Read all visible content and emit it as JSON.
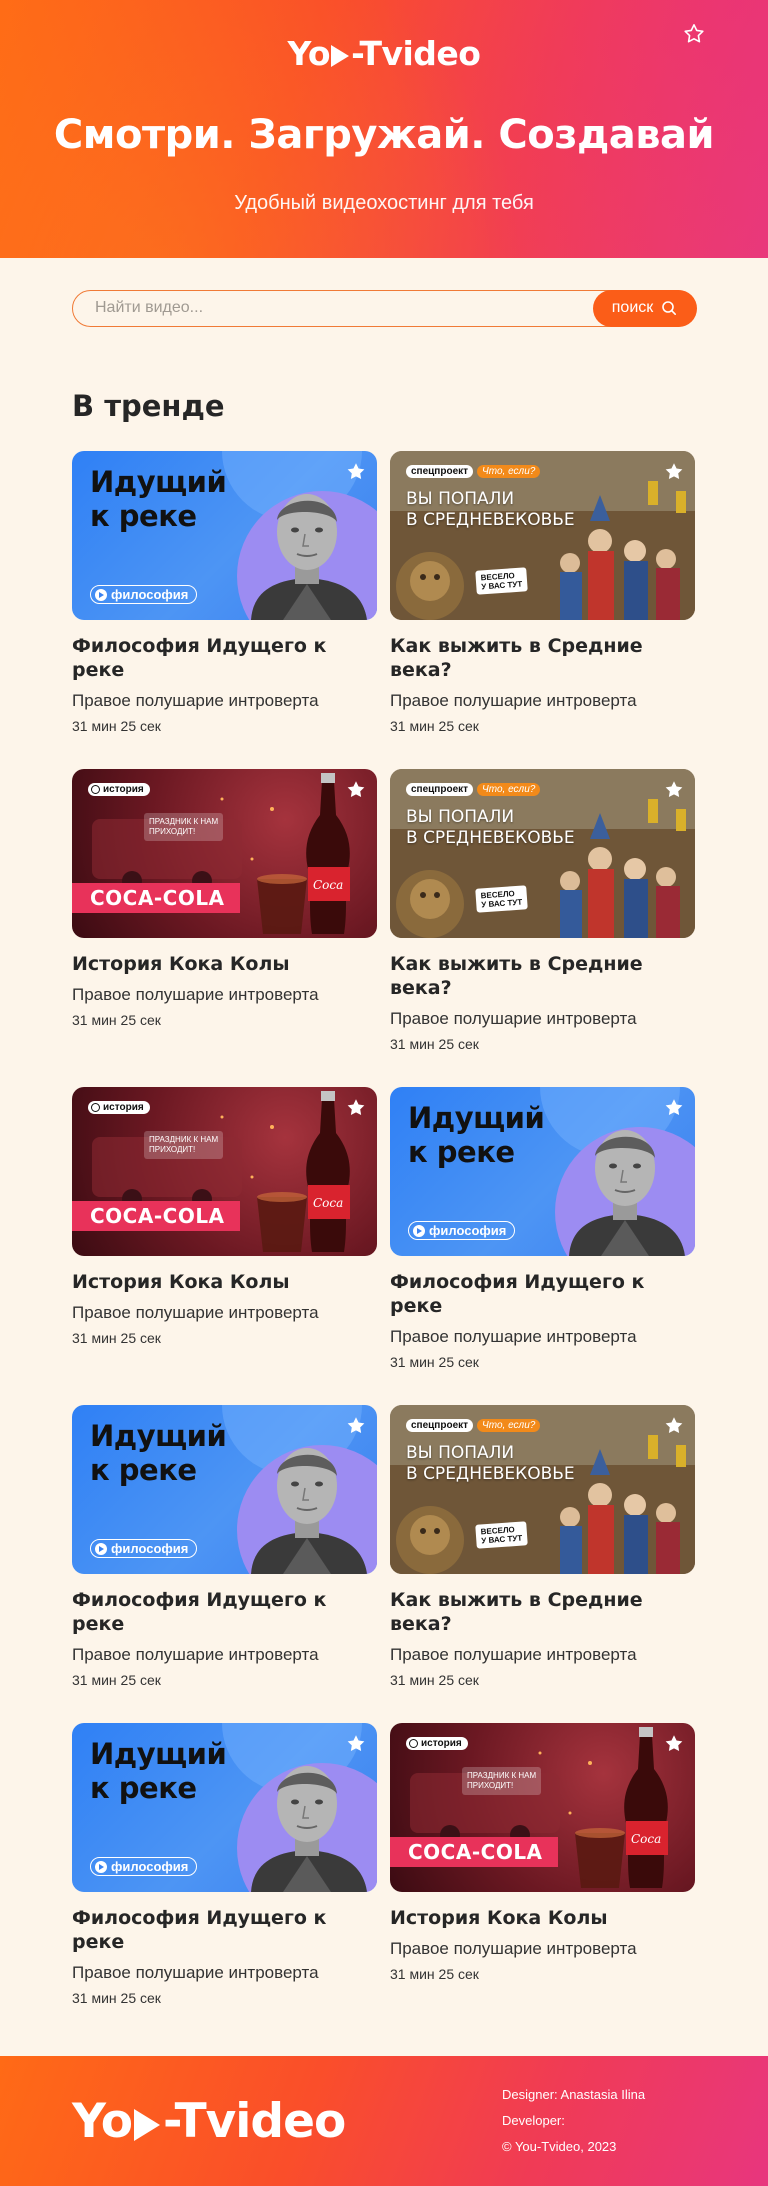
{
  "header": {
    "logo_before": "Yo",
    "logo_after": "-Tvideo",
    "favorite_icon": "star-outline-icon",
    "headline": "Смотри. Загружай. Создавай",
    "subtitle": "Удобный видеохостинг для тебя",
    "gradient": [
      "#ff6a16",
      "#fa4e2a",
      "#e93a7a"
    ]
  },
  "search": {
    "placeholder": "Найти видео...",
    "value": "",
    "button_label": "поиск",
    "button_icon": "search-icon",
    "accent": "#fb5d18"
  },
  "trending": {
    "title": "В тренде",
    "thumbnails": {
      "philosophy": {
        "title_line1": "Идущий",
        "title_line2": "к реке",
        "badge": "философия"
      },
      "medieval": {
        "tag": "спецпроект",
        "tag_accent": "Что, если?",
        "title_line1": "ВЫ ПОПАЛИ",
        "title_line2": "В СРЕДНЕВЕКОВЬЕ",
        "speech_line1": "ВЕСЕЛО",
        "speech_line2": "У ВАС ТУТ"
      },
      "cola": {
        "tag": "история",
        "note_line1": "ПРАЗДНИК К НАМ",
        "note_line2": "ПРИХОДИТ!",
        "banner": "COCA-COLA"
      }
    },
    "cards": [
      {
        "kind": "philosophy",
        "title": "Философия Идущего к реке",
        "author": "Правое полушарие интроверта",
        "duration": "31 мин 25 сек"
      },
      {
        "kind": "medieval",
        "title": "Как выжить в Средние века?",
        "author": "Правое полушарие интроверта",
        "duration": "31 мин 25 сек"
      },
      {
        "kind": "cola",
        "title": "История Кока Колы",
        "author": "Правое полушарие интроверта",
        "duration": "31 мин 25 сек"
      },
      {
        "kind": "medieval",
        "title": "Как выжить в Средние века?",
        "author": "Правое полушарие интроверта",
        "duration": "31 мин 25 сек"
      },
      {
        "kind": "cola",
        "title": "История Кока Колы",
        "author": "Правое полушарие интроверта",
        "duration": "31 мин 25 сек"
      },
      {
        "kind": "philosophy",
        "title": "Философия Идущего к реке",
        "author": "Правое полушарие интроверта",
        "duration": "31 мин 25 сек"
      },
      {
        "kind": "philosophy",
        "title": "Философия Идущего к реке",
        "author": "Правое полушарие интроверта",
        "duration": "31 мин 25 сек"
      },
      {
        "kind": "medieval",
        "title": "Как выжить в Средние века?",
        "author": "Правое полушарие интроверта",
        "duration": "31 мин 25 сек"
      },
      {
        "kind": "philosophy",
        "title": "Философия Идущего к реке",
        "author": "Правое полушарие интроверта",
        "duration": "31 мин 25 сек"
      },
      {
        "kind": "cola",
        "title": "История Кока Колы",
        "author": "Правое полушарие интроверта",
        "duration": "31 мин 25 сек"
      }
    ]
  },
  "footer": {
    "logo_before": "Yo",
    "logo_after": "-Tvideo",
    "designer": "Designer: Anastasia Ilina",
    "developer": "Developer:",
    "copyright": "© You-Tvideo, 2023"
  }
}
